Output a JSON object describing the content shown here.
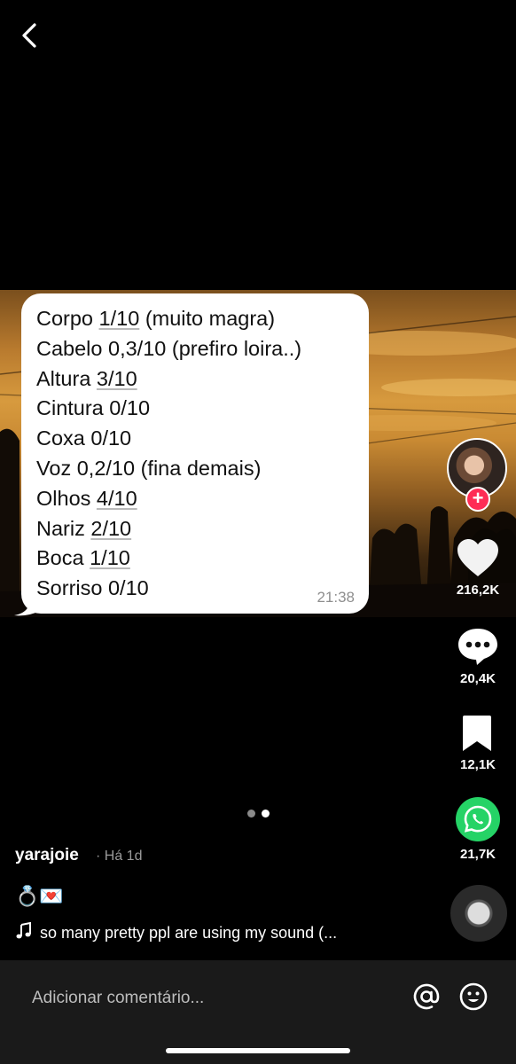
{
  "nav": {
    "back_icon": "chevron-left-icon"
  },
  "message": {
    "lines": [
      [
        "Corpo ",
        "1/10",
        " (muito magra)"
      ],
      [
        "Cabelo 0,3/10 (prefiro loira..)",
        "",
        ""
      ],
      [
        "Altura ",
        "3/10",
        ""
      ],
      [
        "Cintura 0/10",
        "",
        ""
      ],
      [
        "Coxa 0/10",
        "",
        ""
      ],
      [
        "Voz 0,2/10 (fina demais)",
        "",
        ""
      ],
      [
        "Olhos ",
        "4/10",
        ""
      ],
      [
        "Nariz ",
        "2/10",
        ""
      ],
      [
        "Boca ",
        "1/10",
        ""
      ],
      [
        "Sorriso 0/10",
        "",
        ""
      ]
    ],
    "time": "21:38"
  },
  "actions": {
    "likes": "216,2K",
    "comments": "20,4K",
    "saves": "12,1K",
    "shares": "21,7K",
    "follow_symbol": "+"
  },
  "carousel": {
    "total": 2,
    "active_index": 1
  },
  "post": {
    "username": "yarajoie",
    "time_ago": "· Há 1d",
    "caption": "💍💌",
    "sound": "so many pretty ppl are using my sound (..."
  },
  "comment_bar": {
    "placeholder": "Adicionar comentário..."
  },
  "colors": {
    "follow_red": "#fe2c55",
    "whatsapp_green": "#25d366",
    "background": "#000000",
    "comment_bar_bg": "#1a1a1a"
  }
}
